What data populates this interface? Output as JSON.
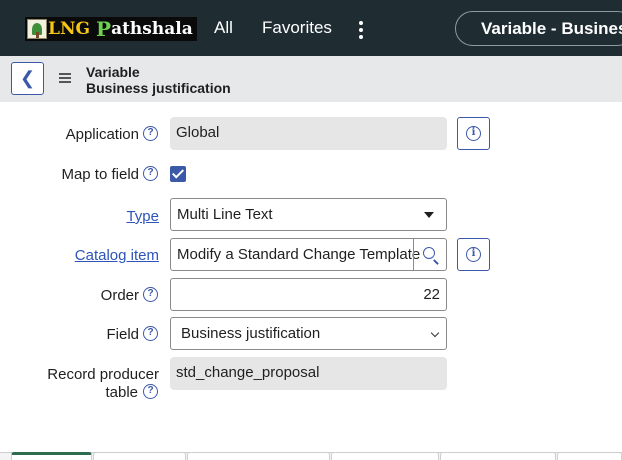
{
  "nav": {
    "logo_text_lng": "LNG",
    "logo_text_p": "P",
    "logo_text_rest": "athshala",
    "all": "All",
    "favorites": "Favorites",
    "more_icon": "more-vertical-icon",
    "record_pill": "Variable - Business"
  },
  "header": {
    "line1": "Variable",
    "line2": "Business justification"
  },
  "form": {
    "application_label": "Application",
    "application_value": "Global",
    "map_to_field_label": "Map to field",
    "map_to_field_checked": true,
    "type_label": "Type",
    "type_value": "Multi Line Text",
    "catalog_item_label": "Catalog item",
    "catalog_item_value": "Modify a Standard Change Template",
    "order_label": "Order",
    "order_value": "22",
    "field_label": "Field",
    "field_value": "Business justification",
    "record_producer_table_label_1": "Record producer",
    "record_producer_table_label_2": "table",
    "record_producer_table_value": "std_change_proposal"
  },
  "colors": {
    "accent": "#3c59a8",
    "nav_bg": "#1f2d33",
    "header_bg": "#e6e8ea"
  }
}
